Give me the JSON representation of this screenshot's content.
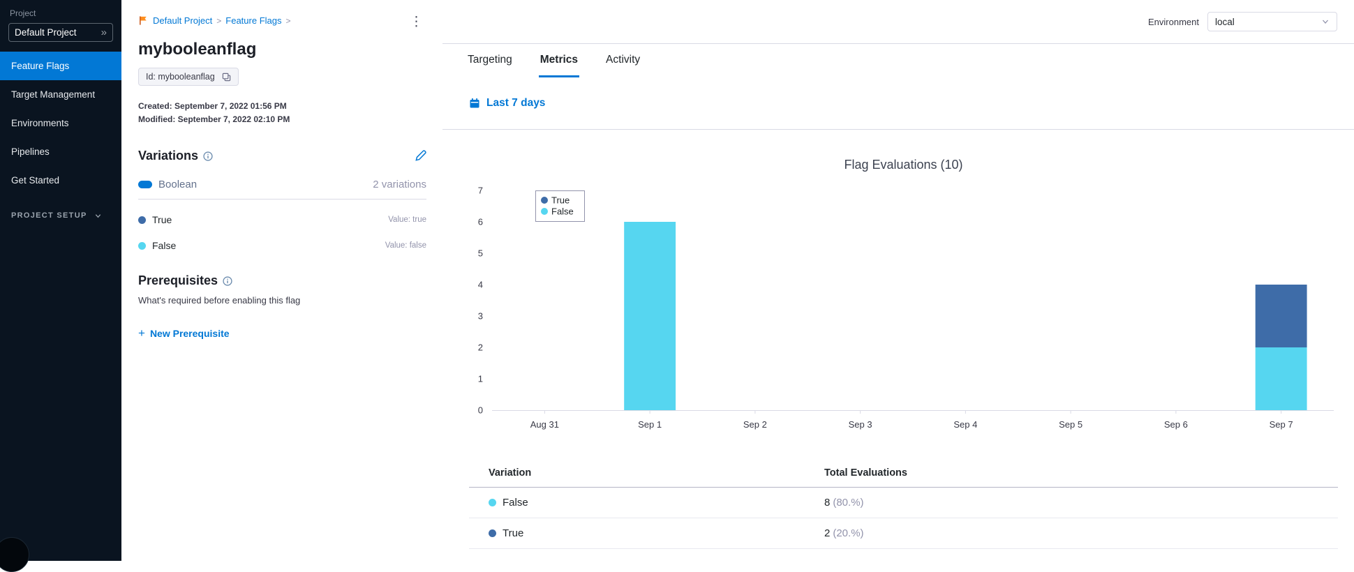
{
  "sidebar": {
    "project_label": "Project",
    "project_name": "Default Project",
    "items": [
      {
        "label": "Feature Flags",
        "active": true
      },
      {
        "label": "Target Management",
        "active": false
      },
      {
        "label": "Environments",
        "active": false
      },
      {
        "label": "Pipelines",
        "active": false
      },
      {
        "label": "Get Started",
        "active": false
      }
    ],
    "project_setup": "PROJECT SETUP"
  },
  "flag_panel": {
    "breadcrumb": {
      "project": "Default Project",
      "section": "Feature Flags",
      "separator": ">"
    },
    "title": "mybooleanflag",
    "id_chip": "Id: mybooleanflag",
    "created": "Created: September 7, 2022 01:56 PM",
    "modified": "Modified: September 7, 2022 02:10 PM",
    "variations": {
      "heading": "Variations",
      "type": "Boolean",
      "count": "2 variations",
      "items": [
        {
          "name": "True",
          "value": "Value: true",
          "color": "#3e6ca8"
        },
        {
          "name": "False",
          "value": "Value: false",
          "color": "#56d6f0"
        }
      ]
    },
    "prerequisites": {
      "heading": "Prerequisites",
      "description": "What's required before enabling this flag",
      "new_button": "New Prerequisite"
    }
  },
  "header": {
    "environment_label": "Environment",
    "environment_value": "local",
    "tabs": [
      {
        "label": "Targeting",
        "active": false
      },
      {
        "label": "Metrics",
        "active": true
      },
      {
        "label": "Activity",
        "active": false
      }
    ],
    "date_filter": "Last 7 days"
  },
  "chart_data": {
    "type": "bar",
    "stacked": true,
    "title": "Flag Evaluations (10)",
    "categories": [
      "Aug 31",
      "Sep 1",
      "Sep 2",
      "Sep 3",
      "Sep 4",
      "Sep 5",
      "Sep 6",
      "Sep 7"
    ],
    "series": [
      {
        "name": "True",
        "color": "#3e6ca8",
        "values": [
          0,
          0,
          0,
          0,
          0,
          0,
          0,
          2
        ]
      },
      {
        "name": "False",
        "color": "#56d6f0",
        "values": [
          0,
          6,
          0,
          0,
          0,
          0,
          0,
          2
        ]
      }
    ],
    "ylim": [
      0,
      7
    ],
    "yticks": [
      0,
      1,
      2,
      3,
      4,
      5,
      6,
      7
    ],
    "legend_position": "top-left",
    "grid": false
  },
  "table": {
    "columns": [
      "Variation",
      "Total Evaluations"
    ],
    "rows": [
      {
        "variation": "False",
        "color": "#56d6f0",
        "total": "8",
        "pct": "(80.%)"
      },
      {
        "variation": "True",
        "color": "#3e6ca8",
        "total": "2",
        "pct": "(20.%)"
      }
    ]
  }
}
